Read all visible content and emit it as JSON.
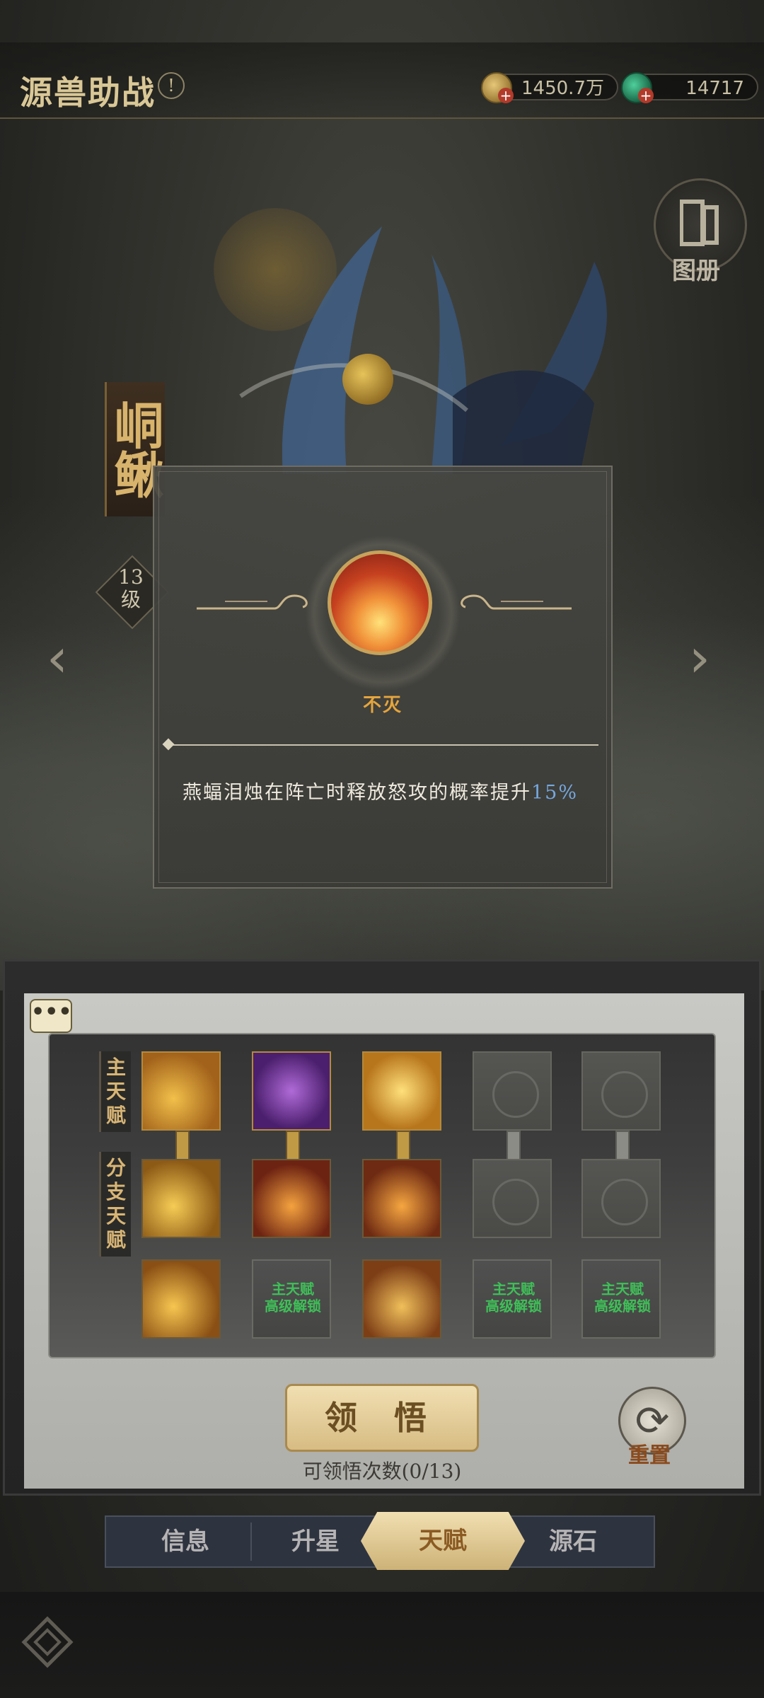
{
  "header": {
    "title": "源兽助战",
    "help_icon": "!",
    "copper": "1450.7万",
    "jade": "14717"
  },
  "gallery": {
    "label": "图册"
  },
  "creature": {
    "name": "峒鳅",
    "level_number": "13",
    "level_unit": "级"
  },
  "popup": {
    "talent_name": "不灭",
    "description_prefix": "燕蝠泪烛在阵亡时释放怒攻的概率提升",
    "description_value": "15%"
  },
  "panel": {
    "chat_icon": "•••",
    "main_label": "主天赋",
    "branch_label": "分支天赋",
    "locked_note_line1": "主天赋",
    "locked_note_line2": "高级解锁",
    "learn_button": "领 悟",
    "learn_count": "可领悟次数(0/13)",
    "reset_label": "重置"
  },
  "tabs": [
    "信息",
    "升星",
    "天赋",
    "源石"
  ],
  "colors": {
    "accent_gold": "#d9c796",
    "talent_name": "#e5a53c",
    "highlight_value": "#76a8de",
    "locked_note": "#3fbf58"
  }
}
